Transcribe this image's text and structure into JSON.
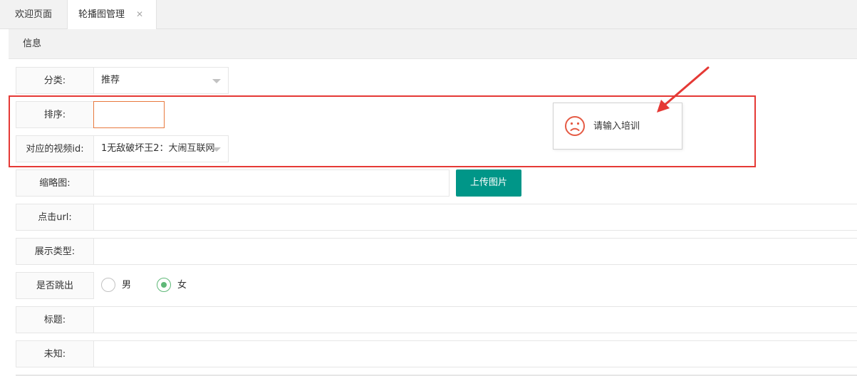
{
  "tabs": [
    {
      "label": "欢迎页面"
    },
    {
      "label": "轮播图管理",
      "close": "✕"
    }
  ],
  "section": {
    "title": "信息"
  },
  "form": {
    "category": {
      "label": "分类:",
      "value": "推荐"
    },
    "sort": {
      "label": "排序:",
      "value": ""
    },
    "video_id": {
      "label": "对应的视频id:",
      "value": "1无敌破坏王2：大闹互联网"
    },
    "thumbnail": {
      "label": "缩略图:",
      "value": "",
      "upload_label": "上传图片"
    },
    "click_url": {
      "label": "点击url:",
      "value": ""
    },
    "display_type": {
      "label": "展示类型:",
      "value": ""
    },
    "jump": {
      "label": "是否跳出",
      "options": [
        "男",
        "女"
      ],
      "selected": "女"
    },
    "title": {
      "label": "标题:",
      "value": ""
    },
    "unknown": {
      "label": "未知:",
      "value": ""
    }
  },
  "toast": {
    "message": "请输入培训",
    "icon": "sad-face-icon"
  },
  "colors": {
    "accent": "#009688",
    "error": "#e53935",
    "radio": "#5FB878",
    "input_focus": "#e8793e"
  }
}
